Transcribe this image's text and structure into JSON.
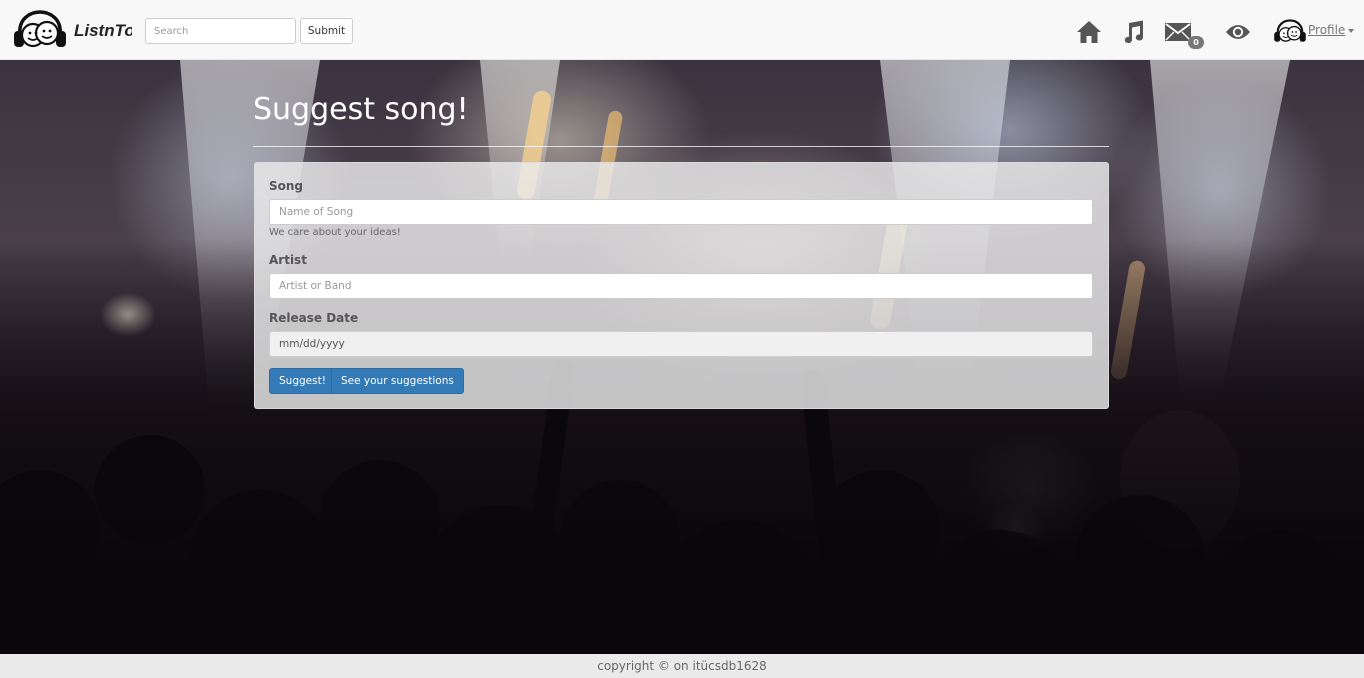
{
  "navbar": {
    "brand": "ListnTo",
    "search": {
      "placeholder": "Search",
      "value": ""
    },
    "submit_label": "Submit",
    "icons": [
      "home-icon",
      "music-icon",
      "envelope-icon",
      "eye-icon"
    ],
    "mail_count": "0",
    "profile_label": "Profile"
  },
  "main": {
    "title": "Suggest song!",
    "song": {
      "label": "Song",
      "placeholder": "Name of Song",
      "help": "We care about your ideas!"
    },
    "artist": {
      "label": "Artist",
      "placeholder": "Artist or Band"
    },
    "release_date": {
      "label": "Release Date",
      "value": "mm/dd/yyyy"
    },
    "suggest_label": "Suggest!",
    "see_suggestions_label": "See your suggestions"
  },
  "footer": {
    "text": "copyright © on itücsdb1628"
  },
  "colors": {
    "primary": "#337ab7",
    "navbar": "#f8f8f8",
    "footer": "#eaeaea"
  }
}
